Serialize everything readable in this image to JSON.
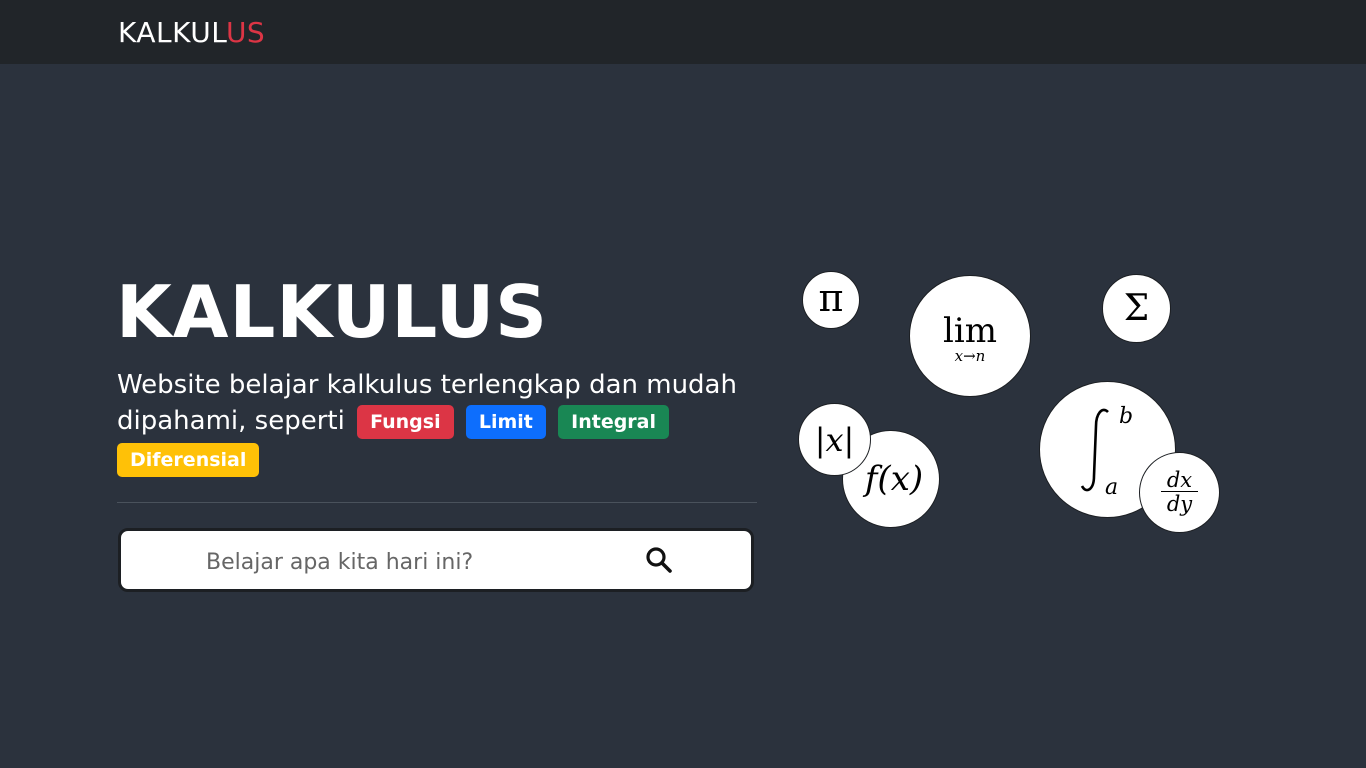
{
  "navbar": {
    "brand_main": "KALKUL",
    "brand_accent": "US"
  },
  "hero": {
    "title": "KALKULUS",
    "description_line1": "Website belajar kalkulus terlengkap dan mudah",
    "description_line2": "dipahami, seperti",
    "badges": [
      {
        "label": "Fungsi",
        "color": "#dc3545"
      },
      {
        "label": "Limit",
        "color": "#0d6efd"
      },
      {
        "label": "Integral",
        "color": "#198754"
      },
      {
        "label": "Diferensial",
        "color": "#ffc107"
      }
    ]
  },
  "search": {
    "placeholder": "Belajar apa kita hari ini?",
    "icon": "search-icon"
  },
  "math_symbols": {
    "pi": "π",
    "limit": "lim",
    "limit_sub": "x→n",
    "sigma": "Σ",
    "absolute": "|x|",
    "function": "f(x)",
    "integral_upper": "b",
    "integral_lower": "a",
    "derivative_num": "dx",
    "derivative_den": "dy"
  },
  "colors": {
    "background": "#2b323d",
    "navbar": "#212529",
    "accent": "#dc3545"
  }
}
